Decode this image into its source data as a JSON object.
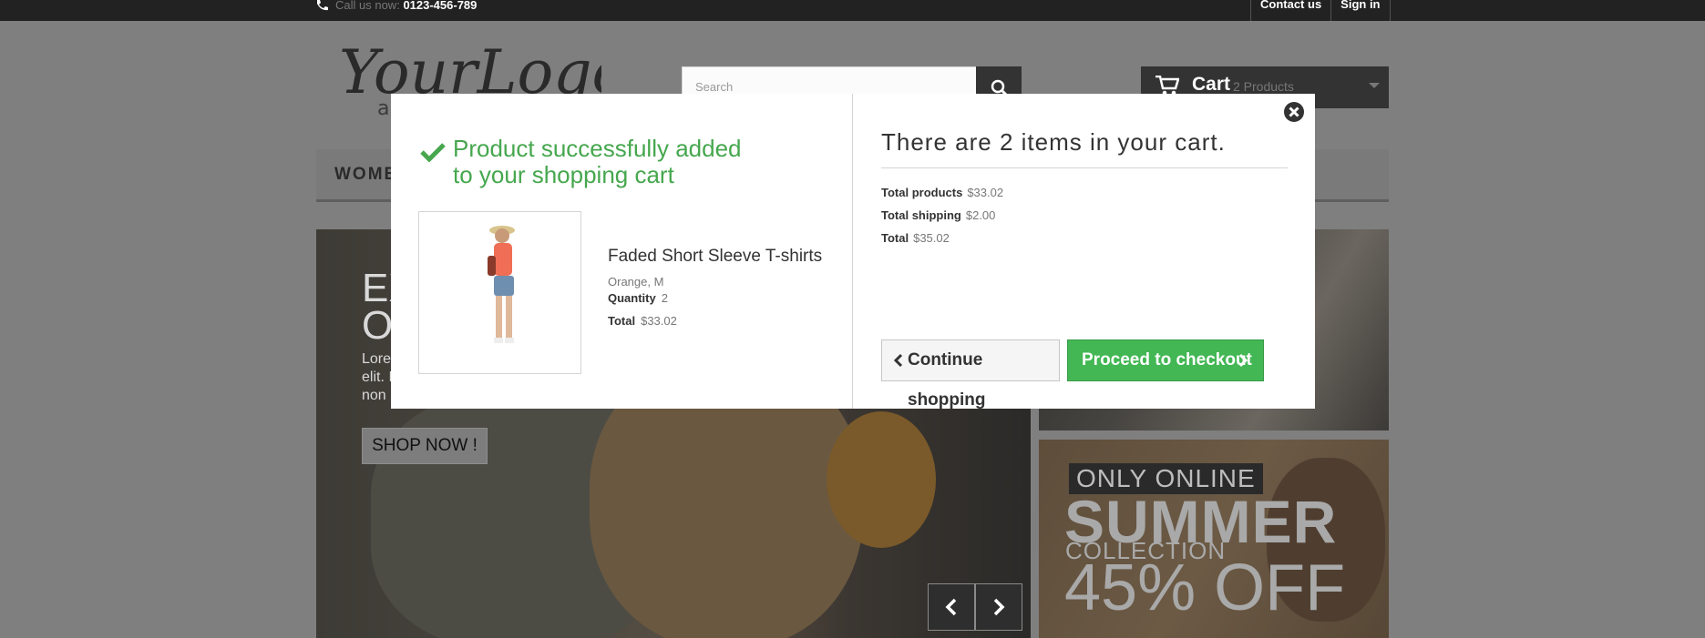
{
  "header": {
    "phone_prefix": "Call us now:",
    "phone_number": "0123-456-789",
    "links": [
      "Contact us",
      "Sign in"
    ],
    "logo_text": "YourLogo",
    "logo_tagline": "a",
    "search_placeholder": "Search",
    "cart_label": "Cart",
    "cart_count": "2 Products"
  },
  "menu": {
    "visible_item": "WOMEN"
  },
  "slider": {
    "heading_line1": "EX",
    "heading_line2": "OC",
    "text_line1": "Lore",
    "text_line2": "elit. I",
    "text_line3": "non",
    "button_label": "SHOP NOW !"
  },
  "banner2": {
    "badge": "ONLY ONLINE",
    "headline": "SUMMER",
    "subline": "COLLECTION",
    "discount": "45% OFF"
  },
  "modal": {
    "success_title": "Product successfully added to your shopping cart",
    "product": {
      "name": "Faded Short Sleeve T-shirts",
      "attributes": "Orange, M",
      "quantity_label": "Quantity",
      "quantity_value": "2",
      "total_label": "Total",
      "total_value": "$33.02"
    },
    "cart_summary": {
      "title": "There are 2 items in your cart.",
      "products_label": "Total products",
      "products_value": "$33.02",
      "shipping_label": "Total shipping",
      "shipping_value": "$2.00",
      "total_label": "Total",
      "total_value": "$35.02"
    },
    "continue_label": "Continue shopping",
    "checkout_label": "Proceed to checkout",
    "accent_color": "#46a74e"
  }
}
